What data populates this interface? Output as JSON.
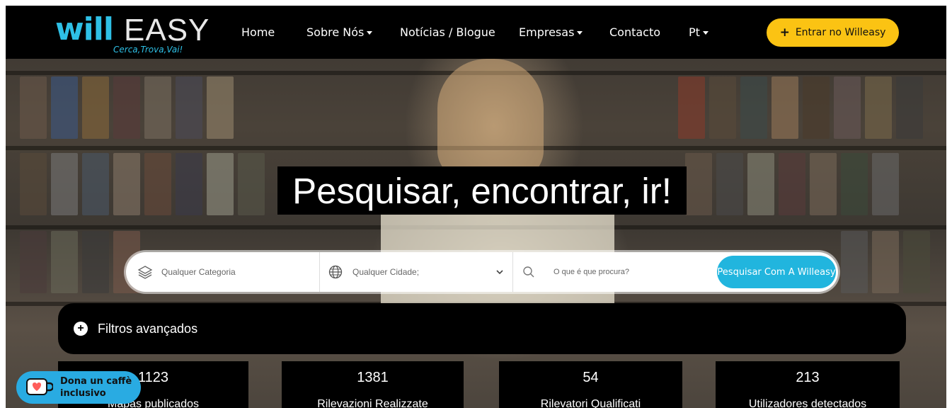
{
  "brand": {
    "logo_will": "will",
    "logo_easy": "EASY",
    "logo_tagline": "Cerca,Trova,Vai!",
    "accent": "#2ec0e6",
    "cta_color": "#fbc313"
  },
  "nav": {
    "items": [
      {
        "label": "Home",
        "dropdown": false
      },
      {
        "label": "Sobre Nós",
        "dropdown": true
      },
      {
        "label": "Notícias / Blogue",
        "dropdown": false
      },
      {
        "label": "Empresas",
        "dropdown": true
      },
      {
        "label": "Contacto",
        "dropdown": false
      },
      {
        "label": "Pt",
        "dropdown": true
      }
    ],
    "cta_label": "Entrar no Willeasy"
  },
  "hero": {
    "headline": "Pesquisar, encontrar, ir!"
  },
  "search": {
    "category_placeholder": "Qualquer Categoria",
    "city_placeholder": "Qualquer Cidade;",
    "query_placeholder": "O que é que procura?",
    "button_label": "Pesquisar Com A Willeasy",
    "icons": [
      "layers-icon",
      "globe-icon",
      "chevron-down-icon",
      "search-icon"
    ]
  },
  "filters": {
    "label": "Filtros avançados"
  },
  "stats": [
    {
      "number": "1123",
      "label": "Mapas publicados"
    },
    {
      "number": "1381",
      "label": "Rilevazioni Realizzate"
    },
    {
      "number": "54",
      "label": "Rilevatori Qualificati"
    },
    {
      "number": "213",
      "label": "Utilizadores detectados"
    }
  ],
  "donate": {
    "line1": "Dona un caffè",
    "line2": "inclusivo",
    "icon": "coffee-cup-heart-icon"
  }
}
